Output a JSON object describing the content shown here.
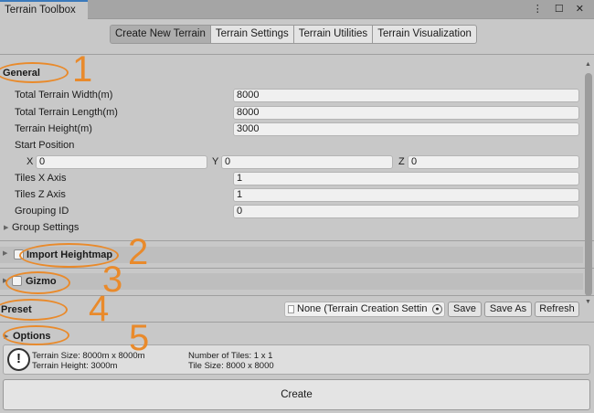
{
  "window": {
    "tab_title": "Terrain Toolbox",
    "controls": "⋮ ☐ ✕"
  },
  "toolbar": {
    "tabs": [
      {
        "label": "Create New Terrain",
        "active": true
      },
      {
        "label": "Terrain Settings",
        "active": false
      },
      {
        "label": "Terrain Utilities",
        "active": false
      },
      {
        "label": "Terrain Visualization",
        "active": false
      }
    ]
  },
  "general": {
    "title": "General",
    "fields": [
      {
        "label": "Total Terrain Width(m)",
        "value": "8000"
      },
      {
        "label": "Total Terrain Length(m)",
        "value": "8000"
      },
      {
        "label": "Terrain Height(m)",
        "value": "3000"
      }
    ],
    "start_position": {
      "label": "Start Position",
      "x_label": "X",
      "x": "0",
      "y_label": "Y",
      "y": "0",
      "z_label": "Z",
      "z": "0"
    },
    "tiles_x": {
      "label": "Tiles X Axis",
      "value": "1"
    },
    "tiles_z": {
      "label": "Tiles Z Axis",
      "value": "1"
    },
    "grouping_id": {
      "label": "Grouping ID",
      "value": "0"
    },
    "group_settings": "Group Settings"
  },
  "import_heightmap": {
    "label": "Import Heightmap",
    "checked": false
  },
  "gizmo": {
    "label": "Gizmo",
    "checked": false
  },
  "preset": {
    "label": "Preset",
    "object_value": "None (Terrain Creation Settin",
    "save": "Save",
    "save_as": "Save As",
    "refresh": "Refresh"
  },
  "options": {
    "label": "Options"
  },
  "info": {
    "terrain_size": "Terrain Size: 8000m x 8000m",
    "terrain_height": "Terrain Height: 3000m",
    "number_of_tiles": "Number of Tiles: 1 x 1",
    "tile_size": "Tile Size: 8000 x 8000"
  },
  "create_button": "Create",
  "annotations": {
    "color": "#e98a2b",
    "numbers": [
      "1",
      "2",
      "3",
      "4",
      "5"
    ]
  }
}
